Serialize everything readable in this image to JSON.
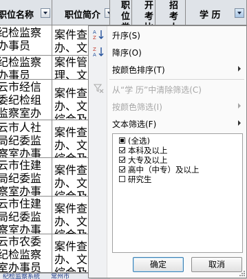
{
  "spreadsheet": {
    "headers": [
      {
        "label": "职位名称"
      },
      {
        "label": "职位简介"
      },
      {
        "label": "职位类"
      },
      {
        "label": "开考比"
      },
      {
        "label": "招考人"
      },
      {
        "label": "学  历"
      }
    ],
    "rows": [
      {
        "name": "纪检监察办事员",
        "intro": "案件查办、文字综合及"
      },
      {
        "name": "纪检监察办事员",
        "intro": "案件管理、文字综合及"
      },
      {
        "name": "云市经信委纪检组监察室办事员",
        "intro": "案件查办、文字综合及"
      },
      {
        "name": "云市人社局纪委监察室办事员",
        "intro": "案件查办、文字综合及"
      },
      {
        "name": "云市住建局纪委监察室办事员",
        "intro": "案件查办、文字综合及"
      },
      {
        "name": "云市住建局纪委监察室办事员",
        "intro": "案件查办、文字综合及"
      },
      {
        "name": "云市农委纪检监察室办事员",
        "intro": "案件查办、文字综合及"
      }
    ],
    "sheet_tabs": [
      "纪检监察系统",
      "常州市"
    ]
  },
  "filter_menu": {
    "sort_asc": "升序(S)",
    "sort_desc": "降序(O)",
    "sort_by_color": "按颜色排序(T)",
    "clear_filter": "从“学  历”中清除筛选(C)",
    "filter_by_color": "按颜色筛选(I)",
    "text_filter": "文本筛选(F)",
    "options": [
      {
        "label": "(全选)",
        "state": "partial"
      },
      {
        "label": "本科及以上",
        "state": "checked"
      },
      {
        "label": "大专及以上",
        "state": "checked"
      },
      {
        "label": "高中（中专）及以上",
        "state": "checked"
      },
      {
        "label": "研究生",
        "state": "unchecked"
      }
    ],
    "ok_label": "确定",
    "cancel_label": "取消"
  },
  "colors": {
    "header_bg": "#dfe3e8",
    "menu_bg": "#fafafa",
    "ok_border": "#3c7fb1"
  }
}
